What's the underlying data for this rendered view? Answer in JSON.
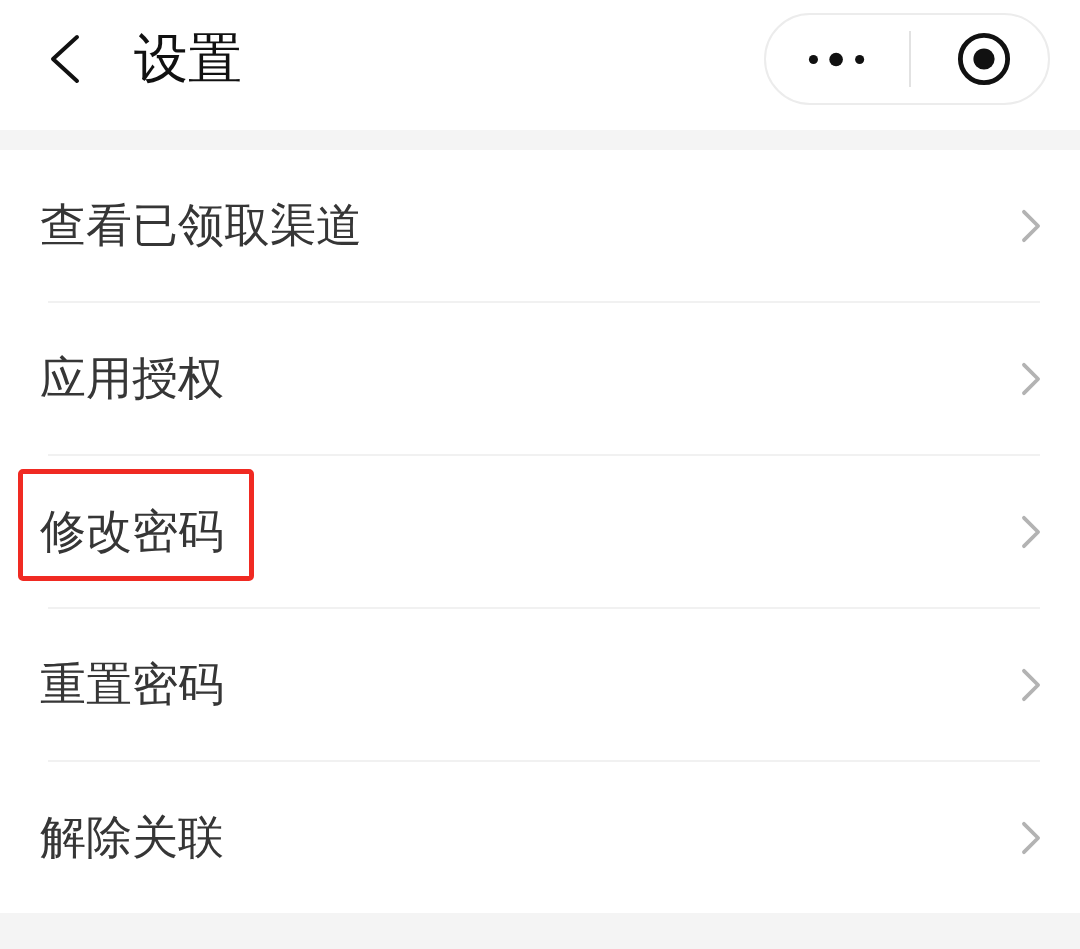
{
  "header": {
    "title": "设置"
  },
  "items": [
    {
      "label": "查看已领取渠道",
      "highlighted": false
    },
    {
      "label": "应用授权",
      "highlighted": false
    },
    {
      "label": "修改密码",
      "highlighted": true
    },
    {
      "label": "重置密码",
      "highlighted": false
    },
    {
      "label": "解除关联",
      "highlighted": false
    }
  ]
}
